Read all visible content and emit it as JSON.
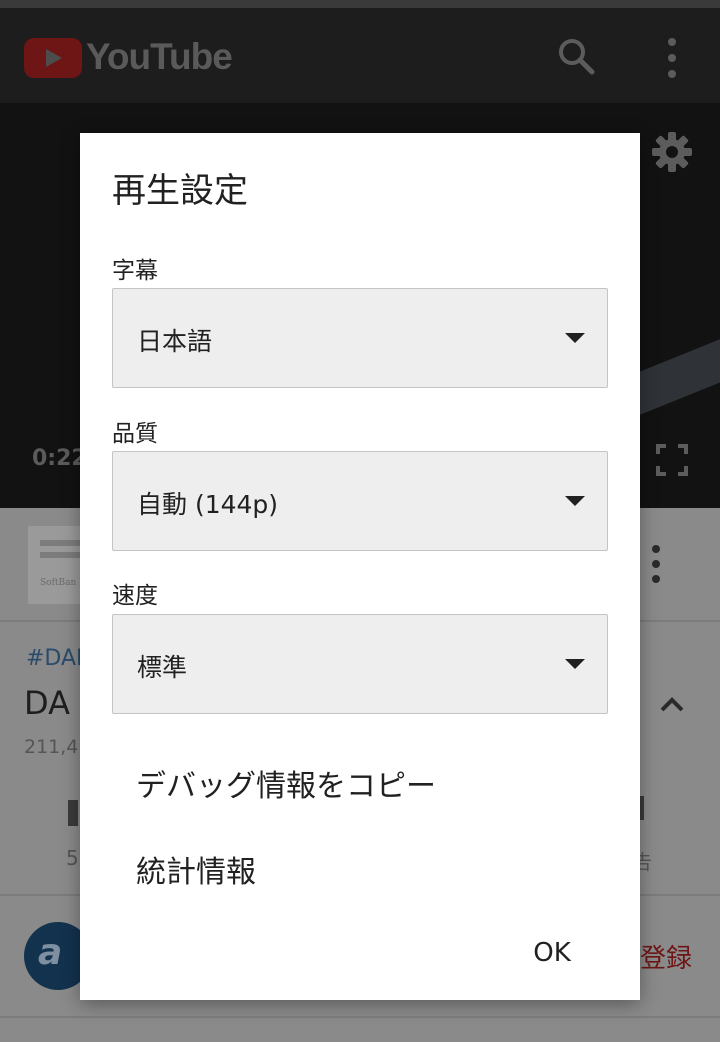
{
  "background": {
    "brand": "YouTube",
    "player_time": "0:22",
    "ad_logo_text": "SoftBan",
    "hashtag": "#DAI",
    "video_title": "DA",
    "views": "211,4",
    "action_left": "5",
    "action_right": "告",
    "channel_avatar_letter": "a",
    "subscribe_label": "登録",
    "colors": {
      "brand_red": "#ff0000",
      "subscribe_red": "#cc0000"
    }
  },
  "dialog": {
    "title": "再生設定",
    "captions": {
      "label": "字幕",
      "value": "日本語"
    },
    "quality": {
      "label": "品質",
      "value": "自動 (144p)"
    },
    "speed": {
      "label": "速度",
      "value": "標準"
    },
    "items": [
      "デバッグ情報をコピー",
      "統計情報"
    ],
    "ok_label": "OK"
  }
}
